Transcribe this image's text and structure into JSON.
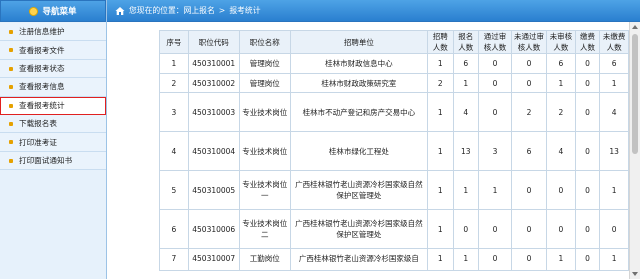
{
  "sidebar": {
    "title": "导航菜单",
    "items": [
      {
        "label": "注册信息维护"
      },
      {
        "label": "查看报考文件"
      },
      {
        "label": "查看报考状态"
      },
      {
        "label": "查看报考信息"
      },
      {
        "label": "查看报考统计"
      },
      {
        "label": "下载报名表"
      },
      {
        "label": "打印准考证"
      },
      {
        "label": "打印面试通知书"
      }
    ]
  },
  "breadcrumb": {
    "prefix": "您现在的位置：",
    "section": "网上报名",
    "separator": ">",
    "current": "报考统计"
  },
  "table": {
    "headers": {
      "seq": "序号",
      "code": "职位代码",
      "name": "职位名称",
      "unit": "招聘单位",
      "recruit": [
        "招聘",
        "人数"
      ],
      "apply": [
        "报名",
        "人数"
      ],
      "passed": [
        "通过审",
        "核人数"
      ],
      "failed": [
        "未通过审",
        "核人数"
      ],
      "unreviewed": [
        "未审核",
        "人数"
      ],
      "paid": [
        "缴费",
        "人数"
      ],
      "unpaid": [
        "未缴费",
        "人数"
      ]
    },
    "rows": [
      {
        "seq": "1",
        "code": "450310001",
        "name": "管理岗位",
        "unit": "桂林市财政信息中心",
        "recruit": "1",
        "apply": "6",
        "passed": "0",
        "failed": "0",
        "unreviewed": "6",
        "paid": "0",
        "unpaid": "6"
      },
      {
        "seq": "2",
        "code": "450310002",
        "name": "管理岗位",
        "unit": "桂林市财政政策研究室",
        "recruit": "2",
        "apply": "1",
        "passed": "0",
        "failed": "0",
        "unreviewed": "1",
        "paid": "0",
        "unpaid": "1"
      },
      {
        "seq": "3",
        "code": "450310003",
        "name": "专业技术岗位",
        "unit": "桂林市不动产登记和房产交易中心",
        "recruit": "1",
        "apply": "4",
        "passed": "0",
        "failed": "2",
        "unreviewed": "2",
        "paid": "0",
        "unpaid": "4"
      },
      {
        "seq": "4",
        "code": "450310004",
        "name": "专业技术岗位",
        "unit": "桂林市绿化工程处",
        "recruit": "1",
        "apply": "13",
        "passed": "3",
        "failed": "6",
        "unreviewed": "4",
        "paid": "0",
        "unpaid": "13"
      },
      {
        "seq": "5",
        "code": "450310005",
        "name": "专业技术岗位一",
        "unit": "广西桂林银竹老山资源冷杉国家级自然保护区管理处",
        "recruit": "1",
        "apply": "1",
        "passed": "1",
        "failed": "0",
        "unreviewed": "0",
        "paid": "0",
        "unpaid": "1"
      },
      {
        "seq": "6",
        "code": "450310006",
        "name": "专业技术岗位二",
        "unit": "广西桂林银竹老山资源冷杉国家级自然保护区管理处",
        "recruit": "1",
        "apply": "0",
        "passed": "0",
        "failed": "0",
        "unreviewed": "0",
        "paid": "0",
        "unpaid": "0"
      },
      {
        "seq": "7",
        "code": "450310007",
        "name": "工勤岗位",
        "unit": "广西桂林银竹老山资源冷杉国家级自",
        "recruit": "1",
        "apply": "1",
        "passed": "0",
        "failed": "0",
        "unreviewed": "1",
        "paid": "0",
        "unpaid": "1"
      }
    ]
  },
  "colors": {
    "header_blue": "#2a7fcf",
    "sidebar_bg": "#e6f1fb",
    "active_outline": "#e02020",
    "bullet": "#e5a100"
  }
}
